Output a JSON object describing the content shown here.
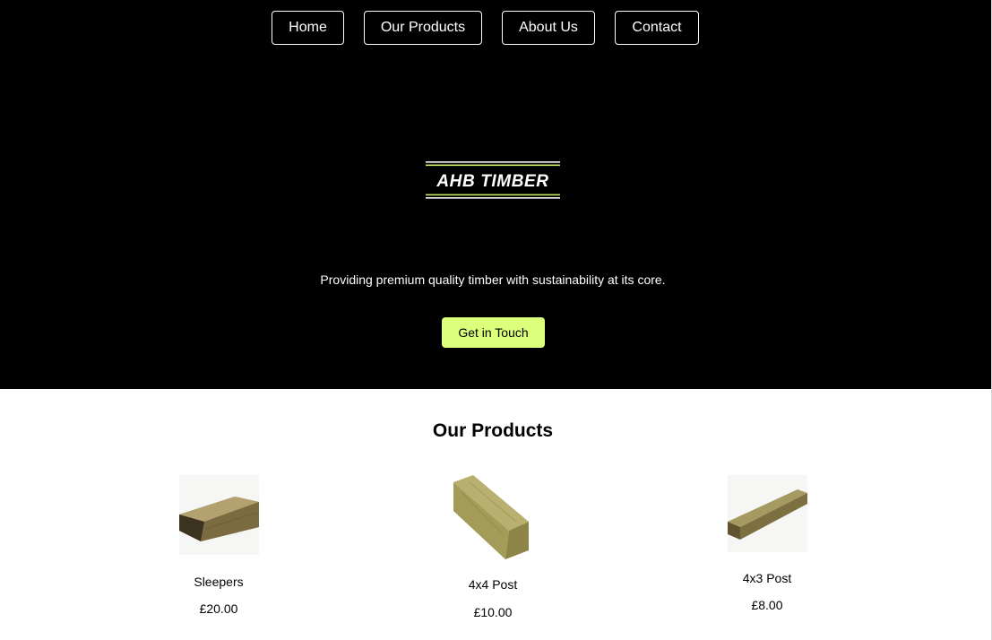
{
  "nav": {
    "items": [
      {
        "label": "Home"
      },
      {
        "label": "Our Products"
      },
      {
        "label": "About Us"
      },
      {
        "label": "Contact"
      }
    ]
  },
  "hero": {
    "logo_text": "AHB TIMBER",
    "tagline": "Providing premium quality timber with sustainability at its core.",
    "cta_label": "Get in Touch"
  },
  "products": {
    "title": "Our Products",
    "items": [
      {
        "name": "Sleepers",
        "price": "£20.00"
      },
      {
        "name": "4x4 Post",
        "price": "£10.00"
      },
      {
        "name": "4x3 Post",
        "price": "£8.00"
      }
    ]
  },
  "colors": {
    "hero_background": "#000000",
    "accent": "#dcff7c",
    "logo_stripe_green": "#c8e86a",
    "logo_stripe_white": "#ffffff"
  }
}
